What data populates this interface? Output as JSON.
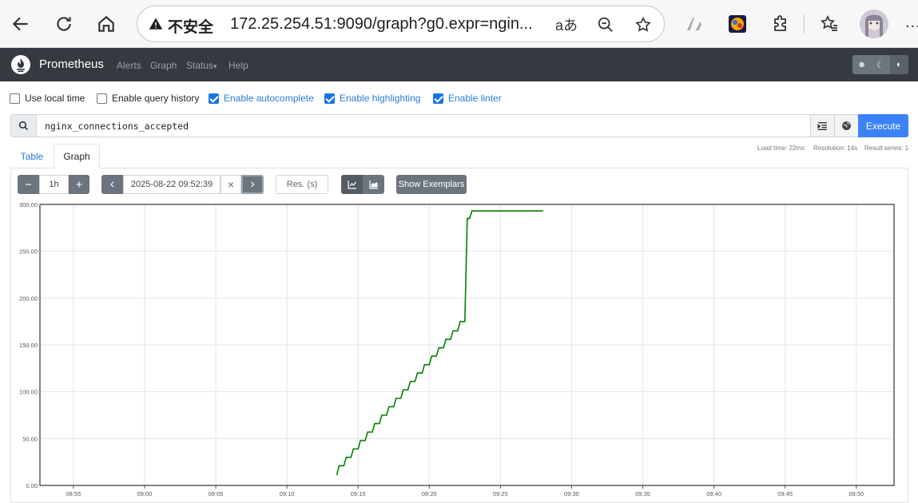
{
  "browser": {
    "security_label": "不安全",
    "url": "172.25.254.51:9090/graph?g0.expr=ngin...",
    "more": "..."
  },
  "nav": {
    "brand": "Prometheus",
    "links": [
      "Alerts",
      "Graph",
      "Status",
      "Help"
    ],
    "status_arrow": "▾"
  },
  "options": [
    {
      "label": "Use local time",
      "checked": false
    },
    {
      "label": "Enable query history",
      "checked": false
    },
    {
      "label": "Enable autocomplete",
      "checked": true
    },
    {
      "label": "Enable highlighting",
      "checked": true
    },
    {
      "label": "Enable linter",
      "checked": true
    }
  ],
  "query": {
    "expression": "nginx_connections_accepted",
    "execute_label": "Execute"
  },
  "tabs": {
    "table": "Table",
    "graph": "Graph"
  },
  "stats": {
    "load_time": "Load time: 22ms",
    "resolution": "Resolution: 14s",
    "result_series": "Result series: 1"
  },
  "controls": {
    "minus": "−",
    "range": "1h",
    "plus": "+",
    "prev": "‹",
    "end_time": "2025-08-22 09:52:39",
    "clear": "×",
    "next": "›",
    "resolution_placeholder": "Res. (s)",
    "show_exemplars": "Show Exemplars"
  },
  "chart_data": {
    "type": "line",
    "series": [
      {
        "line_color": "#008000",
        "x": [
          "09:13:30",
          "09:14:00",
          "09:14:30",
          "09:15:00",
          "09:15:30",
          "09:16:00",
          "09:16:30",
          "09:17:00",
          "09:17:30",
          "09:18:00",
          "09:18:30",
          "09:19:00",
          "09:19:30",
          "09:20:00",
          "09:20:30",
          "09:21:00",
          "09:21:30",
          "09:22:00",
          "09:22:30",
          "09:22:50",
          "09:23:00",
          "09:23:30",
          "09:24:00",
          "09:26:00",
          "09:28:00"
        ],
        "y": [
          11,
          21,
          30,
          39,
          48,
          57,
          66,
          75,
          84,
          93,
          102,
          111,
          120,
          129,
          138,
          147,
          156,
          165,
          175,
          285,
          293,
          293,
          293,
          293,
          293
        ]
      }
    ],
    "x_ticks": [
      "08:55",
      "09:00",
      "09:05",
      "09:10",
      "09:15",
      "09:20",
      "09:25",
      "09:30",
      "09:35",
      "09:40",
      "09:45",
      "09:50"
    ],
    "y_ticks": [
      "0.00",
      "50.00",
      "100.00",
      "150.00",
      "200.00",
      "250.00",
      "300.00"
    ],
    "xlim": [
      "08:52:39",
      "09:52:39"
    ],
    "ylim": [
      0,
      300
    ],
    "grid": true
  }
}
